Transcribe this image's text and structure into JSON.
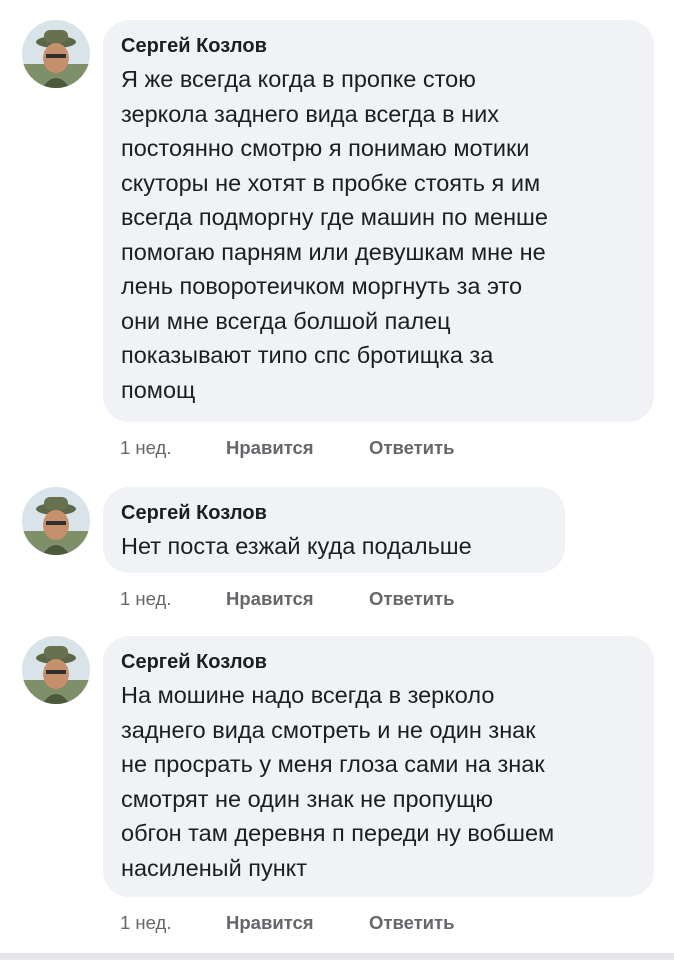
{
  "comments": [
    {
      "author": "Сергей Козлов",
      "text": "Я же всегда когда в пропке стою\nзеркола заднего вида всегда в них\nпостоянно смотрю я понимаю мотики\nскуторы не хотят в пробке стоять я им\nвсегда подморгну где машин по менше\nпомогаю парням или девушкам мне не\nлень поворотеичком моргнуть за это\nони мне всегда болшой палец\nпоказывают типо спс бротищка за\nпомощ",
      "time": "1 нед.",
      "like_label": "Нравится",
      "reply_label": "Ответить"
    },
    {
      "author": "Сергей Козлов",
      "text": "Нет поста езжай куда подальше",
      "time": "1 нед.",
      "like_label": "Нравится",
      "reply_label": "Ответить"
    },
    {
      "author": "Сергей Козлов",
      "text": "На мошине надо всегда в зерколо\nзаднего вида смотреть и не один знак\nне просрать у меня глоза сами на знак\nсмотрят не один знак не пропущю\nобгон там деревня п переди ну вобшем\nнасиленый пункт",
      "time": "1 нед.",
      "like_label": "Нравится",
      "reply_label": "Ответить"
    }
  ]
}
